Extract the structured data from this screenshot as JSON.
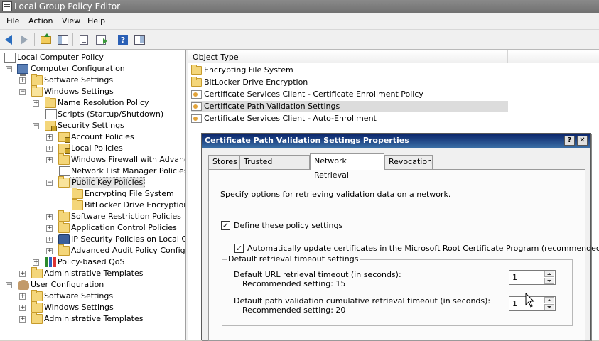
{
  "window": {
    "title": "Local Group Policy Editor"
  },
  "menu": [
    "File",
    "Action",
    "View",
    "Help"
  ],
  "toolbar": {
    "icons": [
      "back-icon",
      "forward-icon",
      "up-folder-icon",
      "show-hide-tree-icon",
      "properties-doc-icon",
      "export-list-icon",
      "help-icon",
      "action-pane-icon"
    ]
  },
  "tree": {
    "items": [
      {
        "label": "Local Computer Policy",
        "icon": "policy-doc-icon"
      },
      {
        "label": "Computer Configuration",
        "icon": "computer-icon",
        "expander": "−"
      },
      {
        "label": "Software Settings",
        "icon": "folder-icon",
        "expander": "+"
      },
      {
        "label": "Windows Settings",
        "icon": "folder-icon",
        "expander": "−"
      },
      {
        "label": "Name Resolution Policy",
        "icon": "folder-icon",
        "expander": "+"
      },
      {
        "label": "Scripts (Startup/Shutdown)",
        "icon": "doc-icon"
      },
      {
        "label": "Security Settings",
        "icon": "lock-folder-icon",
        "expander": "−"
      },
      {
        "label": "Account Policies",
        "icon": "folder-icon",
        "expander": "+"
      },
      {
        "label": "Local Policies",
        "icon": "folder-icon",
        "expander": "+"
      },
      {
        "label": "Windows Firewall with Advanced",
        "icon": "folder-icon",
        "expander": "+"
      },
      {
        "label": "Network List Manager Policies",
        "icon": "doc-icon"
      },
      {
        "label": "Public Key Policies",
        "icon": "folder-icon",
        "expander": "−"
      },
      {
        "label": "Encrypting File System",
        "icon": "folder-icon"
      },
      {
        "label": "BitLocker Drive Encryption",
        "icon": "folder-icon"
      },
      {
        "label": "Software Restriction Policies",
        "icon": "folder-icon",
        "expander": "+"
      },
      {
        "label": "Application Control Policies",
        "icon": "folder-icon",
        "expander": "+"
      },
      {
        "label": "IP Security Policies on Local Comp",
        "icon": "shield-icon",
        "expander": "+"
      },
      {
        "label": "Advanced Audit Policy Configurat",
        "icon": "folder-icon",
        "expander": "+"
      },
      {
        "label": "Policy-based QoS",
        "icon": "chart-icon",
        "expander": "+"
      },
      {
        "label": "Administrative Templates",
        "icon": "folder-icon",
        "expander": "+"
      },
      {
        "label": "User Configuration",
        "icon": "user-icon",
        "expander": "−"
      },
      {
        "label": "Software Settings",
        "icon": "folder-icon",
        "expander": "+"
      },
      {
        "label": "Windows Settings",
        "icon": "folder-icon",
        "expander": "+"
      },
      {
        "label": "Administrative Templates",
        "icon": "folder-icon",
        "expander": "+"
      }
    ],
    "selected": "Public Key Policies"
  },
  "list": {
    "column_header": "Object Type",
    "items": [
      {
        "label": "Encrypting File System",
        "icon": "folder-icon"
      },
      {
        "label": "BitLocker Drive Encryption",
        "icon": "folder-icon"
      },
      {
        "label": "Certificate Services Client - Certificate Enrollment Policy",
        "icon": "certificate-icon"
      },
      {
        "label": "Certificate Path Validation Settings",
        "icon": "certificate-icon"
      },
      {
        "label": "Certificate Services Client - Auto-Enrollment",
        "icon": "certificate-icon"
      }
    ],
    "selected": "Certificate Path Validation Settings"
  },
  "dialog": {
    "title": "Certificate Path Validation Settings Properties",
    "help_button": "?",
    "close_button": "✕",
    "tabs": [
      "Stores",
      "Trusted Publishers",
      "Network Retrieval",
      "Revocation"
    ],
    "active_tab": "Network Retrieval",
    "description": "Specify options for retrieving validation data on a network.",
    "define_checkbox": {
      "label": "Define these policy settings",
      "checked": true,
      "mark": "✓"
    },
    "auto_update_checkbox": {
      "label": "Automatically update certificates in the Microsoft Root Certificate Program (recommended)",
      "checked": true,
      "mark": "✓"
    },
    "group": {
      "label": "Default retrieval timeout settings",
      "url_timeout": {
        "label": "Default URL retrieval timeout (in seconds):",
        "recommended": "Recommended setting: 15",
        "value": "1"
      },
      "path_timeout": {
        "label": "Default path validation cumulative retrieval timeout (in seconds):",
        "recommended": "Recommended setting: 20",
        "value": "1"
      }
    }
  }
}
